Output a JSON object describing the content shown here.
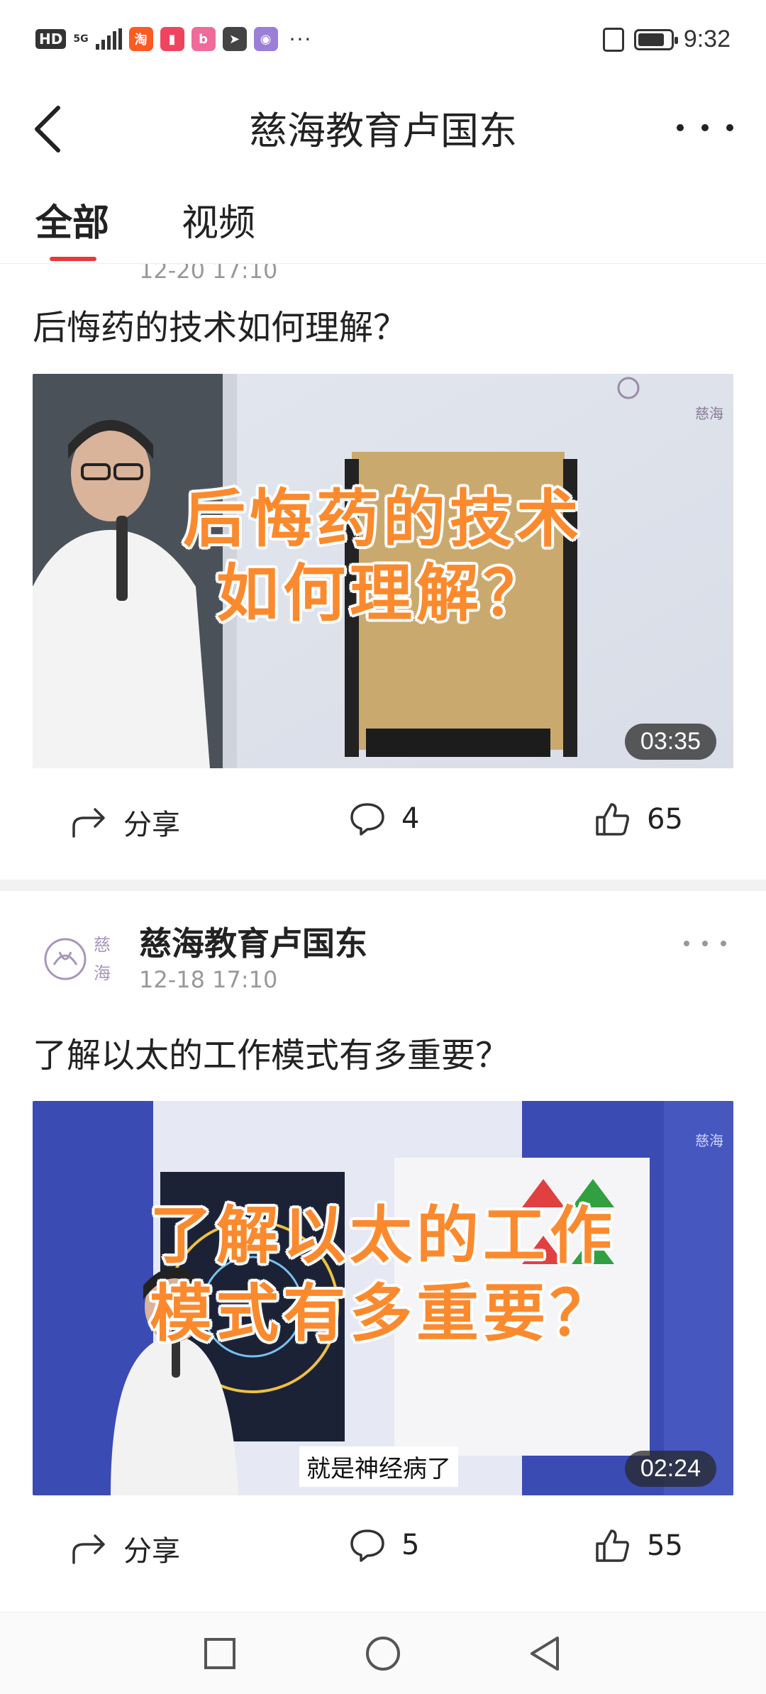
{
  "status_bar": {
    "hd": "HD",
    "network": "5G",
    "time": "9:32",
    "more_dots": "···",
    "app_icons": [
      {
        "name": "taobao",
        "glyph": "淘",
        "color": "#ff5a1f"
      },
      {
        "name": "book",
        "glyph": "▮",
        "color": "#f0445e"
      },
      {
        "name": "bilibili",
        "glyph": "b",
        "color": "#f06a9a"
      },
      {
        "name": "arrow-app",
        "glyph": "➤",
        "color": "#444444"
      },
      {
        "name": "camera-app",
        "glyph": "◉",
        "color": "#9b7ed6"
      }
    ]
  },
  "header": {
    "title": "慈海教育卢国东"
  },
  "tabs": [
    {
      "label": "全部",
      "active": true
    },
    {
      "label": "视频",
      "active": false
    }
  ],
  "posts": [
    {
      "time": "12-20 17:10",
      "title": "后悔药的技术如何理解？",
      "overlay_lines": [
        "后悔药的技术",
        "如何理解？"
      ],
      "duration": "03:35",
      "watermark": "慈海",
      "share_label": "分享",
      "comments": "4",
      "likes": "65"
    },
    {
      "author": "慈海教育卢国东",
      "avatar_text": [
        "慈",
        "海"
      ],
      "time": "12-18 17:10",
      "title": "了解以太的工作模式有多重要？",
      "overlay_lines": [
        "了解以太的工作",
        "模式有多重要？"
      ],
      "subtitle": "就是神经病了",
      "duration": "02:24",
      "watermark": "慈海",
      "share_label": "分享",
      "comments": "5",
      "likes": "55"
    }
  ],
  "colors": {
    "accent": "#e63a3a",
    "overlay_text": "#fb8a2e"
  }
}
